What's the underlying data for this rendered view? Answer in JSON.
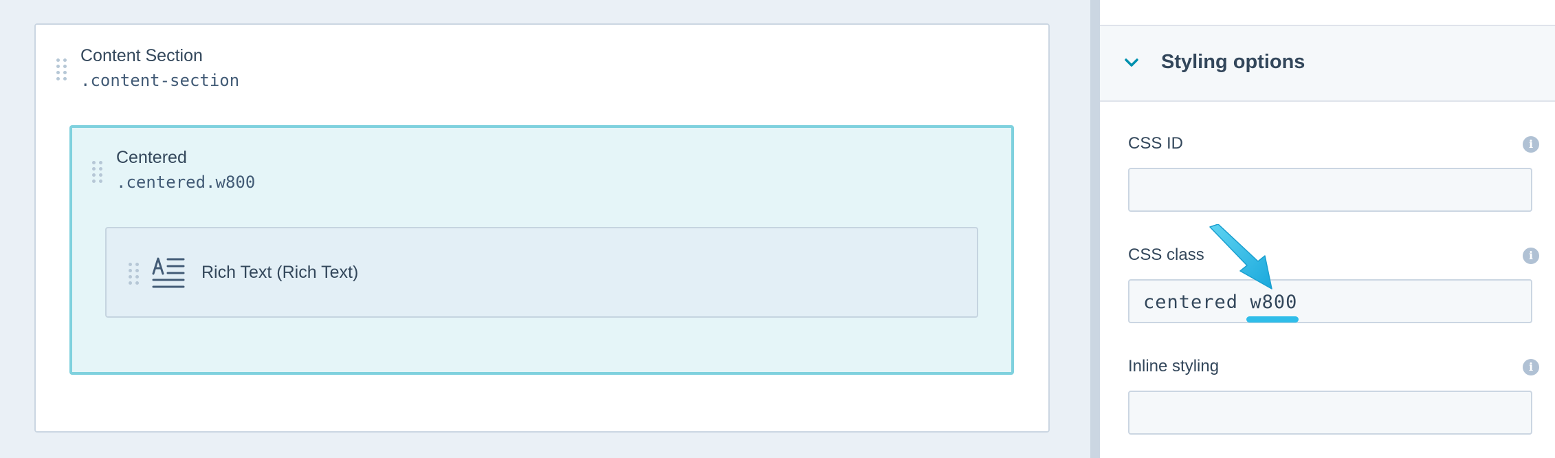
{
  "canvas": {
    "section": {
      "title": "Content Section",
      "class_name": ".content-section"
    },
    "centered": {
      "title": "Centered",
      "class_name": ".centered.w800"
    },
    "rich_text": {
      "label": "Rich Text (Rich Text)",
      "icon": "rich-text-icon"
    }
  },
  "panel": {
    "accordion_title": "Styling options",
    "fields": {
      "css_id": {
        "label": "CSS ID",
        "value": ""
      },
      "css_class": {
        "label": "CSS class",
        "value_prefix": "centered ",
        "value_highlight": "w800"
      },
      "inline_styling": {
        "label": "Inline styling",
        "value": ""
      }
    },
    "info_glyph": "i"
  },
  "colors": {
    "accent_teal": "#7fd1de",
    "highlight_blue": "#2fbde9",
    "text_dark": "#33475b",
    "canvas_bg": "#eaf0f6"
  }
}
